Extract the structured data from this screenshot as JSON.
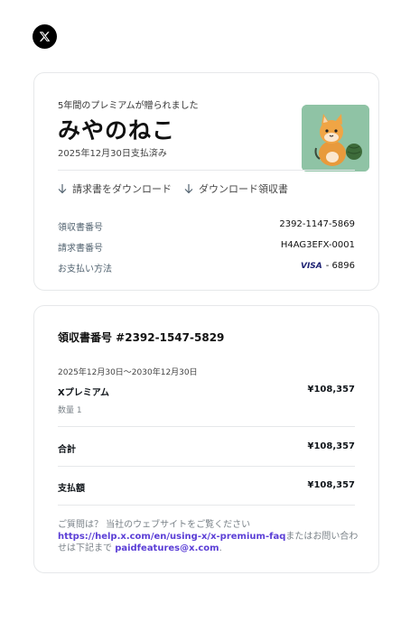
{
  "logo": {
    "icon": "x-logo-icon"
  },
  "summary": {
    "gift_label": "5年間のプレミアムが贈られました",
    "recipient": "みやのねこ",
    "paid_date": "2025年12月30日支払済み",
    "download_invoice": "請求書をダウンロード",
    "download_receipt": "ダウンロード領収書",
    "fields": [
      {
        "label": "領収書番号",
        "value": "2392-1147-5869"
      },
      {
        "label": "請求書番号",
        "value": "H4AG3EFX-0001"
      },
      {
        "label": "お支払い方法",
        "card_brand": "VISA",
        "value": "- 6896"
      }
    ]
  },
  "receipt": {
    "title": "領収書番号 #2392-1547-5829",
    "period": "2025年12月30日～2030年12月30日",
    "item_name": "Xプレミアム",
    "item_price": "¥108,357",
    "quantity": "数量 1",
    "total_label": "合計",
    "total_value": "¥108,357",
    "paid_label": "支払額",
    "paid_value": "¥108,357",
    "footer": {
      "prefix": "ご質問は？ 当社のウェブサイトをご覧ください",
      "help_link": "https://help.x.com/en/using-x/x-premium-faq",
      "middle": "またはお問い合わせは下記まで",
      "email": "paidfeatures@x.com",
      "suffix": "."
    }
  },
  "colors": {
    "link": "#5b3fd6",
    "avatar_bg": "#8fc3a5"
  }
}
